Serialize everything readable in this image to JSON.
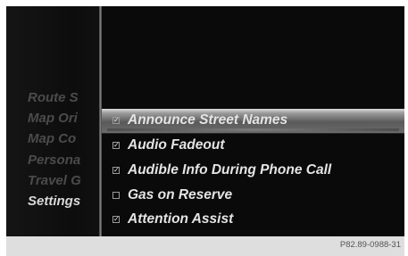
{
  "left_menu": {
    "items": [
      {
        "label": "Route S"
      },
      {
        "label": "Map Ori"
      },
      {
        "label": "Map Co"
      },
      {
        "label": "Persona"
      },
      {
        "label": "Travel G"
      },
      {
        "label": "Settings"
      }
    ],
    "active_label": "Settings"
  },
  "options": [
    {
      "label": "Announce Street Names",
      "checked": true,
      "highlighted": true
    },
    {
      "label": "Audio Fadeout",
      "checked": true,
      "highlighted": false
    },
    {
      "label": "Audible Info During Phone Call",
      "checked": true,
      "highlighted": false
    },
    {
      "label": "Gas on Reserve",
      "checked": false,
      "highlighted": false
    },
    {
      "label": "Attention Assist",
      "checked": true,
      "highlighted": false
    }
  ],
  "checkmark_glyph": "✓",
  "footer": {
    "code": "P82.89-0988-31"
  },
  "colors": {
    "background": "#0c0c0c",
    "text_active": "#e4e4e4",
    "text_inactive": "#4b4b4b"
  }
}
